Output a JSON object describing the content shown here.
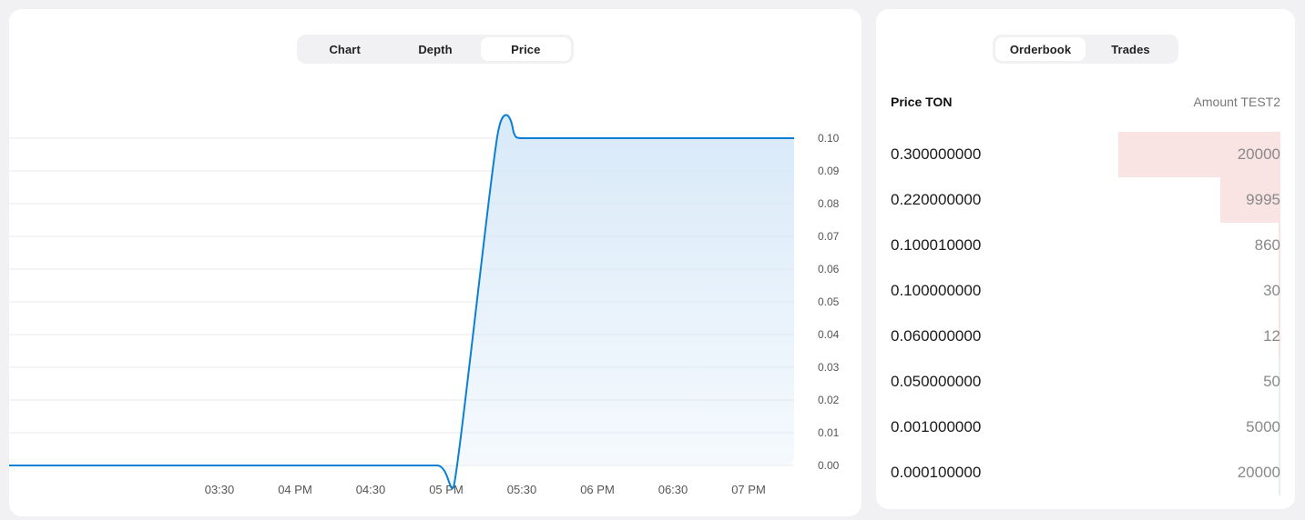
{
  "chart_panel": {
    "tabs": [
      {
        "label": "Chart",
        "active": false
      },
      {
        "label": "Depth",
        "active": false
      },
      {
        "label": "Price",
        "active": true
      }
    ]
  },
  "chart_data": {
    "type": "area",
    "title": "",
    "xlabel": "",
    "ylabel": "",
    "x_tick_labels": [
      "03:30",
      "04 PM",
      "04:30",
      "05 PM",
      "05:30",
      "06 PM",
      "06:30",
      "07 PM"
    ],
    "y_tick_labels": [
      "0.10",
      "0.09",
      "0.08",
      "0.07",
      "0.06",
      "0.05",
      "0.04",
      "0.03",
      "0.02",
      "0.01",
      "0.00"
    ],
    "ylim": [
      0,
      0.1
    ],
    "x_minutes_since_noon": [
      180,
      300,
      309,
      323,
      330,
      420
    ],
    "y_values": [
      0.0,
      0.0,
      0.0,
      0.1,
      0.1,
      0.1
    ],
    "line_color": "#0a7fd4",
    "fill_color": "#d8e9f8",
    "grid": true
  },
  "orderbook": {
    "tabs": [
      {
        "label": "Orderbook",
        "active": true
      },
      {
        "label": "Trades",
        "active": false
      }
    ],
    "header": {
      "price": "Price TON",
      "amount": "Amount TEST2"
    },
    "rows": [
      {
        "price": "0.300000000",
        "amount": "20000",
        "depth": 1.0,
        "side": "ask"
      },
      {
        "price": "0.220000000",
        "amount": "9995",
        "depth": 0.37,
        "side": "ask"
      },
      {
        "price": "0.100010000",
        "amount": "860",
        "depth": 0.01,
        "side": "ask"
      },
      {
        "price": "0.100000000",
        "amount": "30",
        "depth": 0.005,
        "side": "ask"
      },
      {
        "price": "0.060000000",
        "amount": "12",
        "depth": 0.005,
        "side": "ask"
      },
      {
        "price": "0.050000000",
        "amount": "50",
        "depth": 0.005,
        "side": "bid"
      },
      {
        "price": "0.001000000",
        "amount": "5000",
        "depth": 0.01,
        "side": "bid"
      },
      {
        "price": "0.000100000",
        "amount": "20000",
        "depth": 0.01,
        "side": "bid"
      }
    ],
    "ask_color": "#f9e3e3",
    "bid_color": "#e3f3ea"
  }
}
